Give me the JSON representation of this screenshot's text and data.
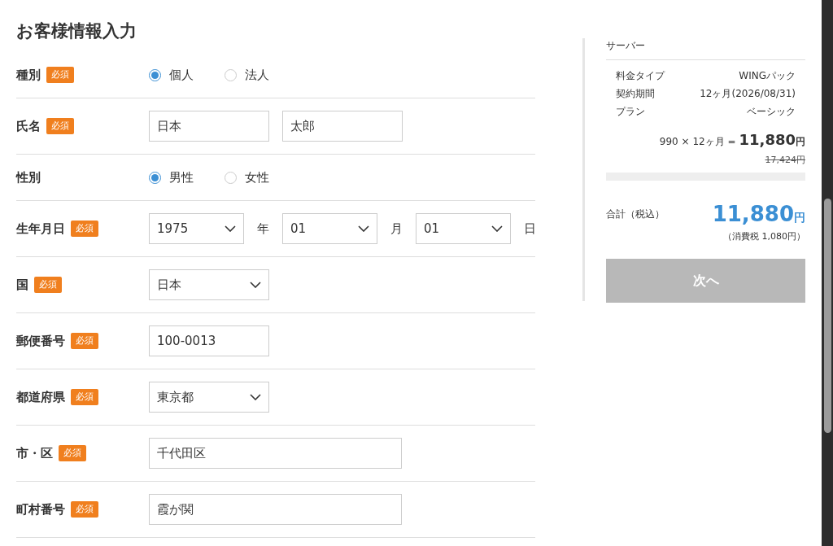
{
  "title": "お客様情報入力",
  "rows": [
    {
      "label": "種別",
      "badge": "必須",
      "fields": [
        {
          "kind": "radio",
          "label": "個人",
          "selected": true
        },
        {
          "kind": "radio",
          "label": "法人",
          "selected": false
        }
      ]
    },
    {
      "label": "氏名",
      "badge": "必須",
      "fields": [
        {
          "kind": "text",
          "value": "日本",
          "wide": false
        },
        {
          "kind": "text",
          "value": "太郎",
          "wide": false
        }
      ]
    },
    {
      "label": "性別",
      "fields": [
        {
          "kind": "radio",
          "label": "男性",
          "selected": true
        },
        {
          "kind": "radio",
          "label": "女性",
          "selected": false
        }
      ]
    },
    {
      "label": "生年月日",
      "badge": "必須",
      "fields": [
        {
          "kind": "select",
          "value": "1975",
          "suffix": "年"
        },
        {
          "kind": "select",
          "value": "01",
          "suffix": "月"
        },
        {
          "kind": "select",
          "value": "01",
          "suffix": "日"
        }
      ]
    },
    {
      "label": "国",
      "badge": "必須",
      "fields": [
        {
          "kind": "select",
          "value": "日本"
        }
      ]
    },
    {
      "label": "郵便番号",
      "badge": "必須",
      "fields": [
        {
          "kind": "text",
          "value": "100-0013",
          "wide": false
        }
      ]
    },
    {
      "label": "都道府県",
      "badge": "必須",
      "fields": [
        {
          "kind": "select",
          "value": "東京都"
        }
      ]
    },
    {
      "label": "市・区",
      "badge": "必須",
      "fields": [
        {
          "kind": "text",
          "value": "千代田区",
          "wide": true
        }
      ]
    },
    {
      "label": "町村番号",
      "badge": "必須",
      "fields": [
        {
          "kind": "text",
          "value": "霞が関",
          "wide": true
        }
      ]
    }
  ],
  "summary": {
    "heading": "サーバー",
    "details": [
      {
        "label": "料金タイプ",
        "value": "WINGパック"
      },
      {
        "label": "契約期間",
        "value": "12ヶ月(2026/08/31)"
      },
      {
        "label": "プラン",
        "value": "ベーシック"
      }
    ],
    "calc": "990 × 12ヶ月 =",
    "price": "11,880",
    "price_unit": "円",
    "old_price": "17,424円",
    "total_label": "合計（税込）",
    "total": "11,880",
    "total_unit": "円",
    "tax": "（消費税 1,080円）",
    "next_button": {
      "label": "次へ",
      "disabled": true
    }
  }
}
